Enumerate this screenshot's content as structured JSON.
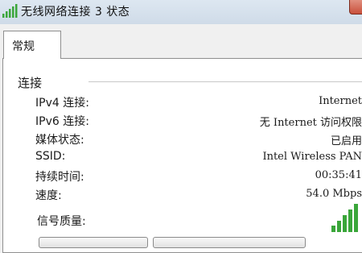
{
  "window": {
    "title": "无线网络连接 3 状态"
  },
  "tabs": [
    {
      "label": "常规"
    }
  ],
  "connection": {
    "section_title": "连接",
    "rows": [
      {
        "label": "IPv4 连接:",
        "value": "Internet"
      },
      {
        "label": "IPv6 连接:",
        "value": "无 Internet 访问权限"
      },
      {
        "label": "媒体状态:",
        "value": "已启用"
      },
      {
        "label": "SSID:",
        "value": "Intel Wireless PAN"
      },
      {
        "label": "持续时间:",
        "value": "00:35:41"
      },
      {
        "label": "速度:",
        "value": "54.0 Mbps"
      }
    ],
    "signal_label": "信号质量:",
    "signal_bars_filled": 5,
    "signal_bars_total": 5
  },
  "colors": {
    "signal": "#3aa63a",
    "title_gradient_top": "#dde7f1",
    "close": "#c9503b"
  }
}
